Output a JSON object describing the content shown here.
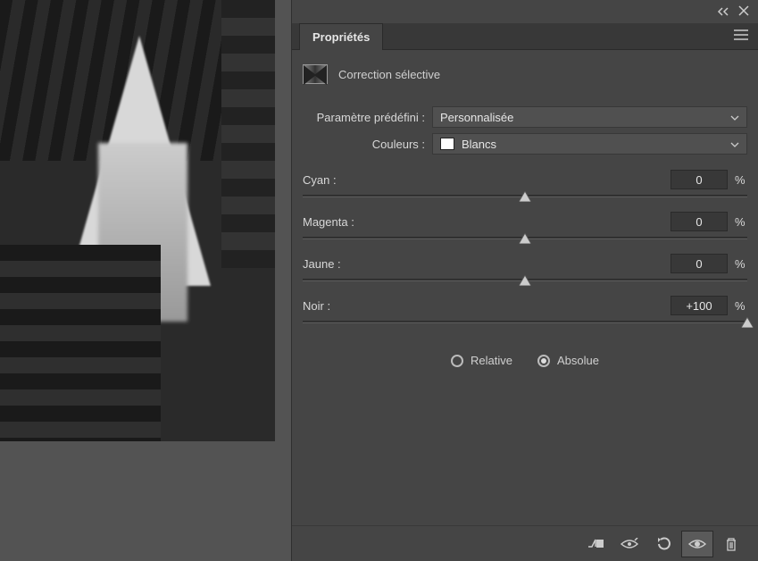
{
  "panel": {
    "tab_label": "Propriétés",
    "adjustment_title": "Correction sélective"
  },
  "preset": {
    "label": "Paramètre prédéfini :",
    "value": "Personnalisée"
  },
  "colors": {
    "label": "Couleurs :",
    "value": "Blancs",
    "swatch": "#ffffff"
  },
  "sliders": {
    "cyan": {
      "label": "Cyan :",
      "value": "0",
      "unit": "%",
      "pos": 50
    },
    "magenta": {
      "label": "Magenta :",
      "value": "0",
      "unit": "%",
      "pos": 50
    },
    "yellow": {
      "label": "Jaune :",
      "value": "0",
      "unit": "%",
      "pos": 50
    },
    "black": {
      "label": "Noir :",
      "value": "+100",
      "unit": "%",
      "pos": 100
    }
  },
  "mode": {
    "relative": "Relative",
    "absolute": "Absolue",
    "selected": "absolute"
  }
}
